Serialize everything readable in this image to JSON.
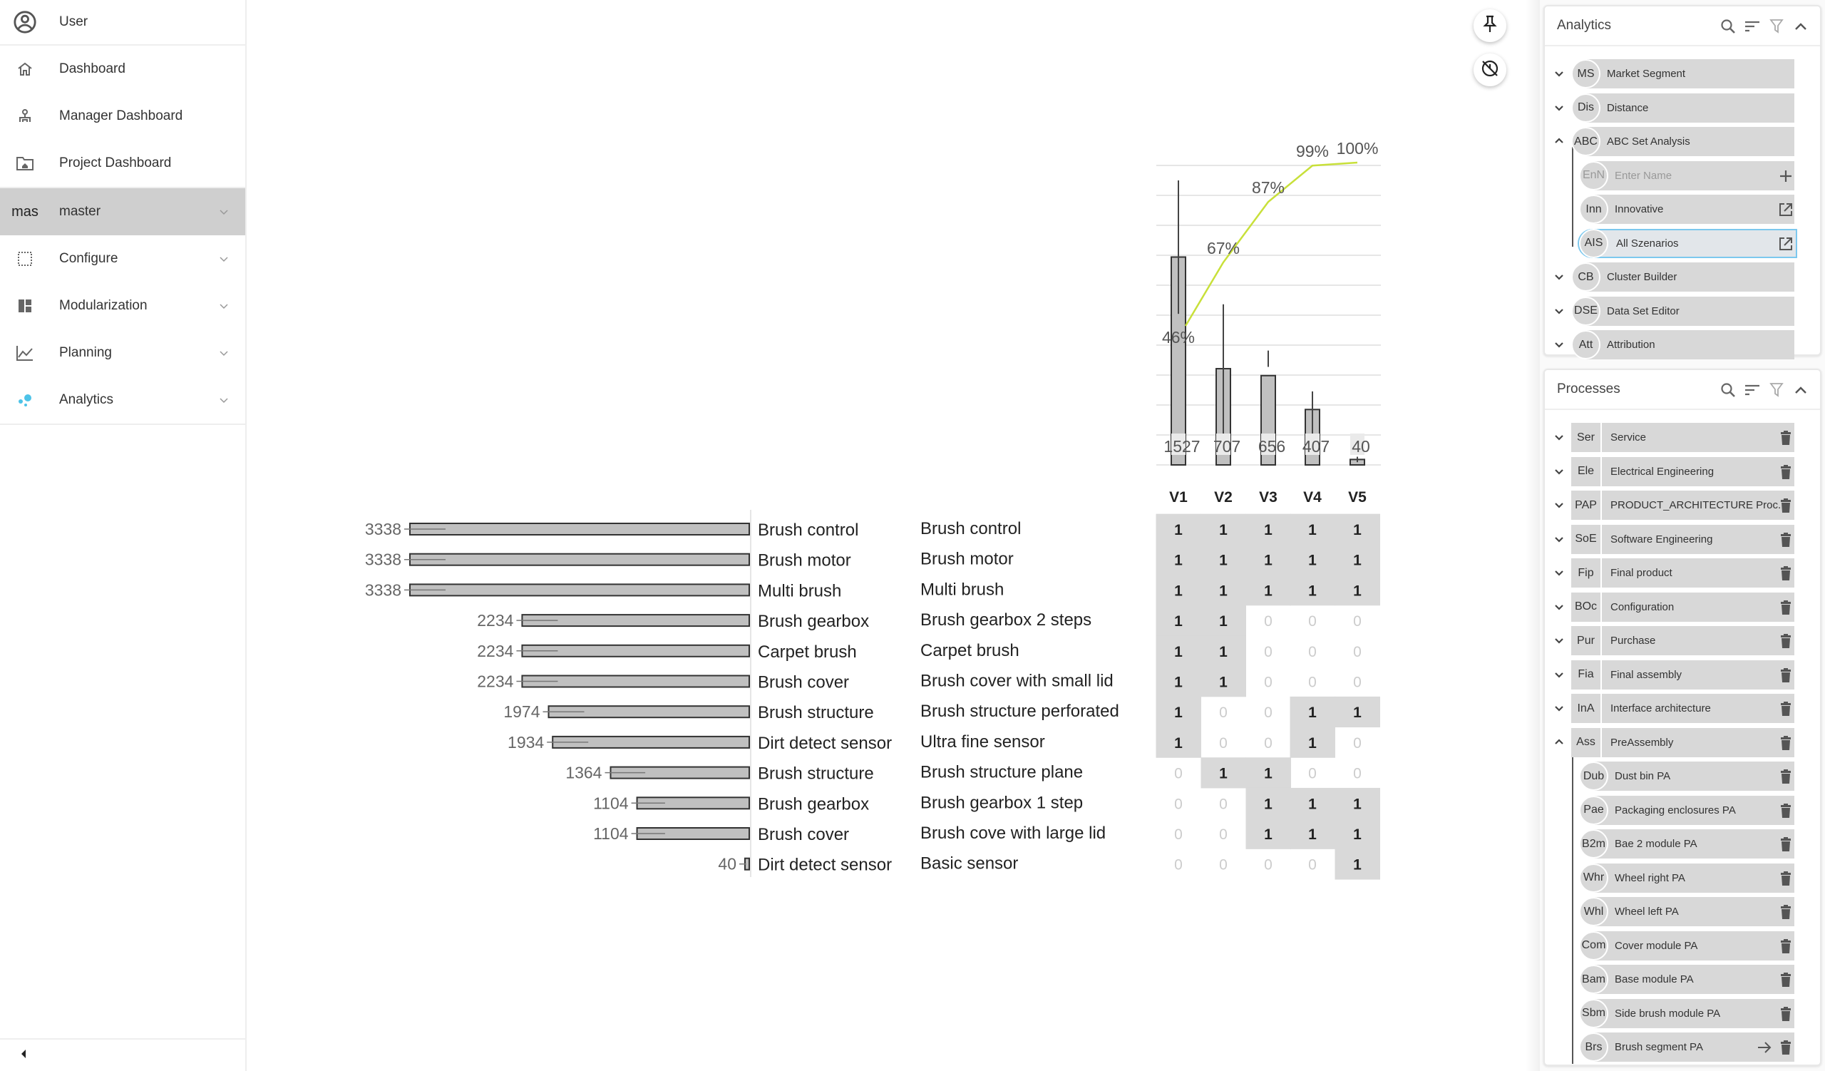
{
  "sidebar": {
    "user_label": "User",
    "items": [
      {
        "label": "Dashboard",
        "icon": "home-icon",
        "chevron": false
      },
      {
        "label": "Manager Dashboard",
        "icon": "org-chart-icon",
        "chevron": false
      },
      {
        "label": "Project Dashboard",
        "icon": "folder-home-icon",
        "chevron": false
      },
      {
        "label": "master",
        "abbr": "mas",
        "chevron": true,
        "active": true
      },
      {
        "label": "Configure",
        "icon": "select-dotted-icon",
        "chevron": true
      },
      {
        "label": "Modularization",
        "icon": "dashboard-tiles-icon",
        "chevron": true
      },
      {
        "label": "Planning",
        "icon": "line-chart-icon",
        "chevron": true
      },
      {
        "label": "Analytics",
        "icon": "bubbles-icon",
        "chevron": true,
        "icon_color": "#4dc3e8"
      }
    ],
    "collapse_icon": "caret-left-icon"
  },
  "floating_buttons": [
    {
      "name": "pin",
      "icon": "pin-icon"
    },
    {
      "name": "hide",
      "icon": "eye-off-icon"
    }
  ],
  "colors": {
    "bar_fill": "#c0c0c0",
    "cumulative_line": "#c8e03a",
    "matrix_fill": "#d9d9d9",
    "selected_border": "#7cc8ee",
    "active_sidebar": "#cfcfcf"
  },
  "chart_data": {
    "type": "bar",
    "title": "",
    "categories": [
      "V1",
      "V2",
      "V3",
      "V4",
      "V5"
    ],
    "values": [
      1527,
      707,
      656,
      407,
      40
    ],
    "cumulative_percent": [
      46,
      67,
      87,
      99,
      100
    ],
    "cumulative_labels": [
      "46%",
      "67%",
      "87%",
      "99%",
      "100%"
    ],
    "error_ranges": [
      [
        1110,
        2090
      ],
      [
        207,
        1180
      ],
      [
        720,
        840
      ],
      [
        150,
        540
      ],
      [
        20,
        60
      ]
    ],
    "ylim": [
      0,
      2200
    ],
    "grid": true,
    "xlabel": "",
    "ylabel": "",
    "features": [
      {
        "count": 3338,
        "feature": "Brush control",
        "variant": "Brush control",
        "matrix": [
          1,
          1,
          1,
          1,
          1
        ]
      },
      {
        "count": 3338,
        "feature": "Brush motor",
        "variant": "Brush motor",
        "matrix": [
          1,
          1,
          1,
          1,
          1
        ]
      },
      {
        "count": 3338,
        "feature": "Multi brush",
        "variant": "Multi brush",
        "matrix": [
          1,
          1,
          1,
          1,
          1
        ]
      },
      {
        "count": 2234,
        "feature": "Brush gearbox",
        "variant": "Brush gearbox 2 steps",
        "matrix": [
          1,
          1,
          0,
          0,
          0
        ]
      },
      {
        "count": 2234,
        "feature": "Carpet brush",
        "variant": "Carpet brush",
        "matrix": [
          1,
          1,
          0,
          0,
          0
        ]
      },
      {
        "count": 2234,
        "feature": "Brush cover",
        "variant": "Brush cover with small lid",
        "matrix": [
          1,
          1,
          0,
          0,
          0
        ]
      },
      {
        "count": 1974,
        "feature": "Brush structure",
        "variant": "Brush structure perforated",
        "matrix": [
          1,
          0,
          0,
          1,
          1
        ]
      },
      {
        "count": 1934,
        "feature": "Dirt detect sensor",
        "variant": "Ultra fine sensor",
        "matrix": [
          1,
          0,
          0,
          1,
          0
        ]
      },
      {
        "count": 1364,
        "feature": "Brush structure",
        "variant": "Brush structure plane",
        "matrix": [
          0,
          1,
          1,
          0,
          0
        ]
      },
      {
        "count": 1104,
        "feature": "Brush gearbox",
        "variant": "Brush gearbox 1 step",
        "matrix": [
          0,
          0,
          1,
          1,
          1
        ]
      },
      {
        "count": 1104,
        "feature": "Brush cover",
        "variant": "Brush cove with large lid",
        "matrix": [
          0,
          0,
          1,
          1,
          1
        ]
      },
      {
        "count": 40,
        "feature": "Dirt detect sensor",
        "variant": "Basic sensor",
        "matrix": [
          0,
          0,
          0,
          0,
          1
        ]
      }
    ],
    "feature_xlim": [
      0,
      3338
    ]
  },
  "analytics_panel": {
    "title": "Analytics",
    "tools": [
      "search-icon",
      "sort-icon",
      "filter-icon",
      "chevron-up-icon"
    ],
    "items": [
      {
        "abbr": "MS",
        "label": "Market Segment",
        "expanded": false
      },
      {
        "abbr": "Dis",
        "label": "Distance",
        "expanded": false
      },
      {
        "abbr": "ABC",
        "label": "ABC Set Analysis",
        "expanded": true,
        "children": [
          {
            "abbr": "EnN",
            "label": "Enter Name",
            "placeholder": true,
            "action": "plus-icon"
          },
          {
            "abbr": "Inn",
            "label": "Innovative",
            "action": "open-external-icon"
          },
          {
            "abbr": "AIS",
            "label": "All Szenarios",
            "action": "open-external-icon",
            "selected": true
          }
        ]
      },
      {
        "abbr": "CB",
        "label": "Cluster Builder",
        "expanded": false
      },
      {
        "abbr": "DSE",
        "label": "Data Set Editor",
        "expanded": false
      },
      {
        "abbr": "Att",
        "label": "Attribution",
        "expanded": false
      }
    ]
  },
  "processes_panel": {
    "title": "Processes",
    "tools": [
      "search-icon",
      "sort-icon",
      "filter-icon",
      "chevron-up-icon"
    ],
    "items": [
      {
        "abbr": "Ser",
        "label": "Service"
      },
      {
        "abbr": "Ele",
        "label": "Electrical Engineering"
      },
      {
        "abbr": "PAP",
        "label": "PRODUCT_ARCHITECTURE Proc..."
      },
      {
        "abbr": "SoE",
        "label": "Software Engineering"
      },
      {
        "abbr": "Fip",
        "label": "Final product"
      },
      {
        "abbr": "BOc",
        "label": "Configuration"
      },
      {
        "abbr": "Pur",
        "label": "Purchase"
      },
      {
        "abbr": "Fia",
        "label": "Final assembly"
      },
      {
        "abbr": "InA",
        "label": "Interface architecture"
      },
      {
        "abbr": "Ass",
        "label": "PreAssembly",
        "expanded": true,
        "children": [
          {
            "abbr": "Dub",
            "label": "Dust bin PA"
          },
          {
            "abbr": "Pae",
            "label": "Packaging enclosures PA"
          },
          {
            "abbr": "B2m",
            "label": "Bae 2 module PA"
          },
          {
            "abbr": "Whr",
            "label": "Wheel right PA"
          },
          {
            "abbr": "Whl",
            "label": "Wheel left PA"
          },
          {
            "abbr": "Com",
            "label": "Cover module PA"
          },
          {
            "abbr": "Bam",
            "label": "Base module PA"
          },
          {
            "abbr": "Sbm",
            "label": "Side brush module PA"
          },
          {
            "abbr": "Brs",
            "label": "Brush segment PA",
            "arrow": true
          }
        ]
      }
    ]
  }
}
